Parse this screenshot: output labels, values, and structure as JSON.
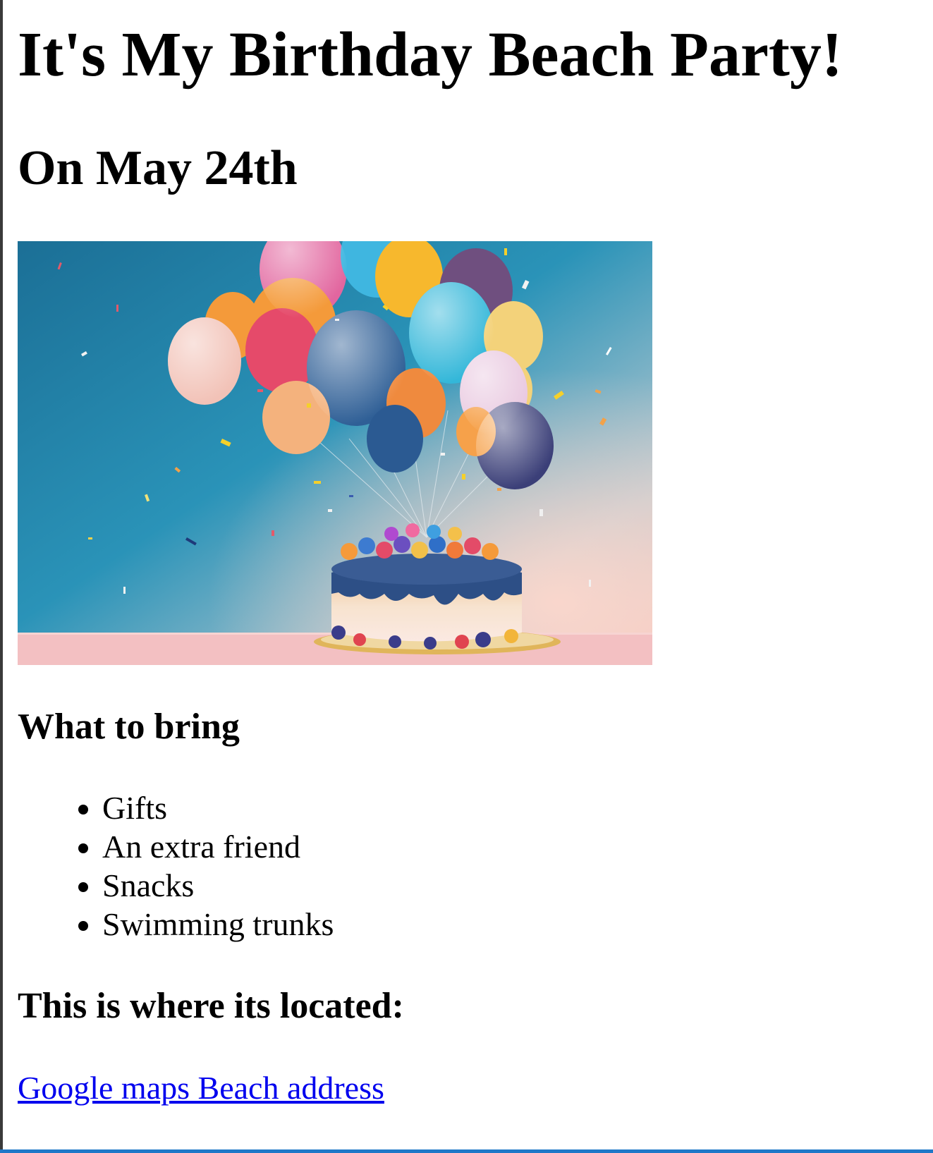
{
  "page": {
    "title": "It's My Birthday Beach Party!",
    "date_heading": "On May 24th"
  },
  "image": {
    "subject": "birthday-cake-with-balloons",
    "colors": {
      "background_top": "#1e7fa8",
      "background_bottom": "#f2c4bf",
      "table": "#f3c3c4"
    }
  },
  "bring": {
    "heading": "What to bring",
    "items": [
      "Gifts",
      "An extra friend",
      "Snacks",
      "Swimming trunks"
    ]
  },
  "location": {
    "heading": "This is where its located:",
    "link_text": "Google maps Beach address"
  },
  "colors": {
    "link": "#0000ee",
    "bottom_border": "#1f78c8",
    "left_border": "#3a3a3a"
  }
}
